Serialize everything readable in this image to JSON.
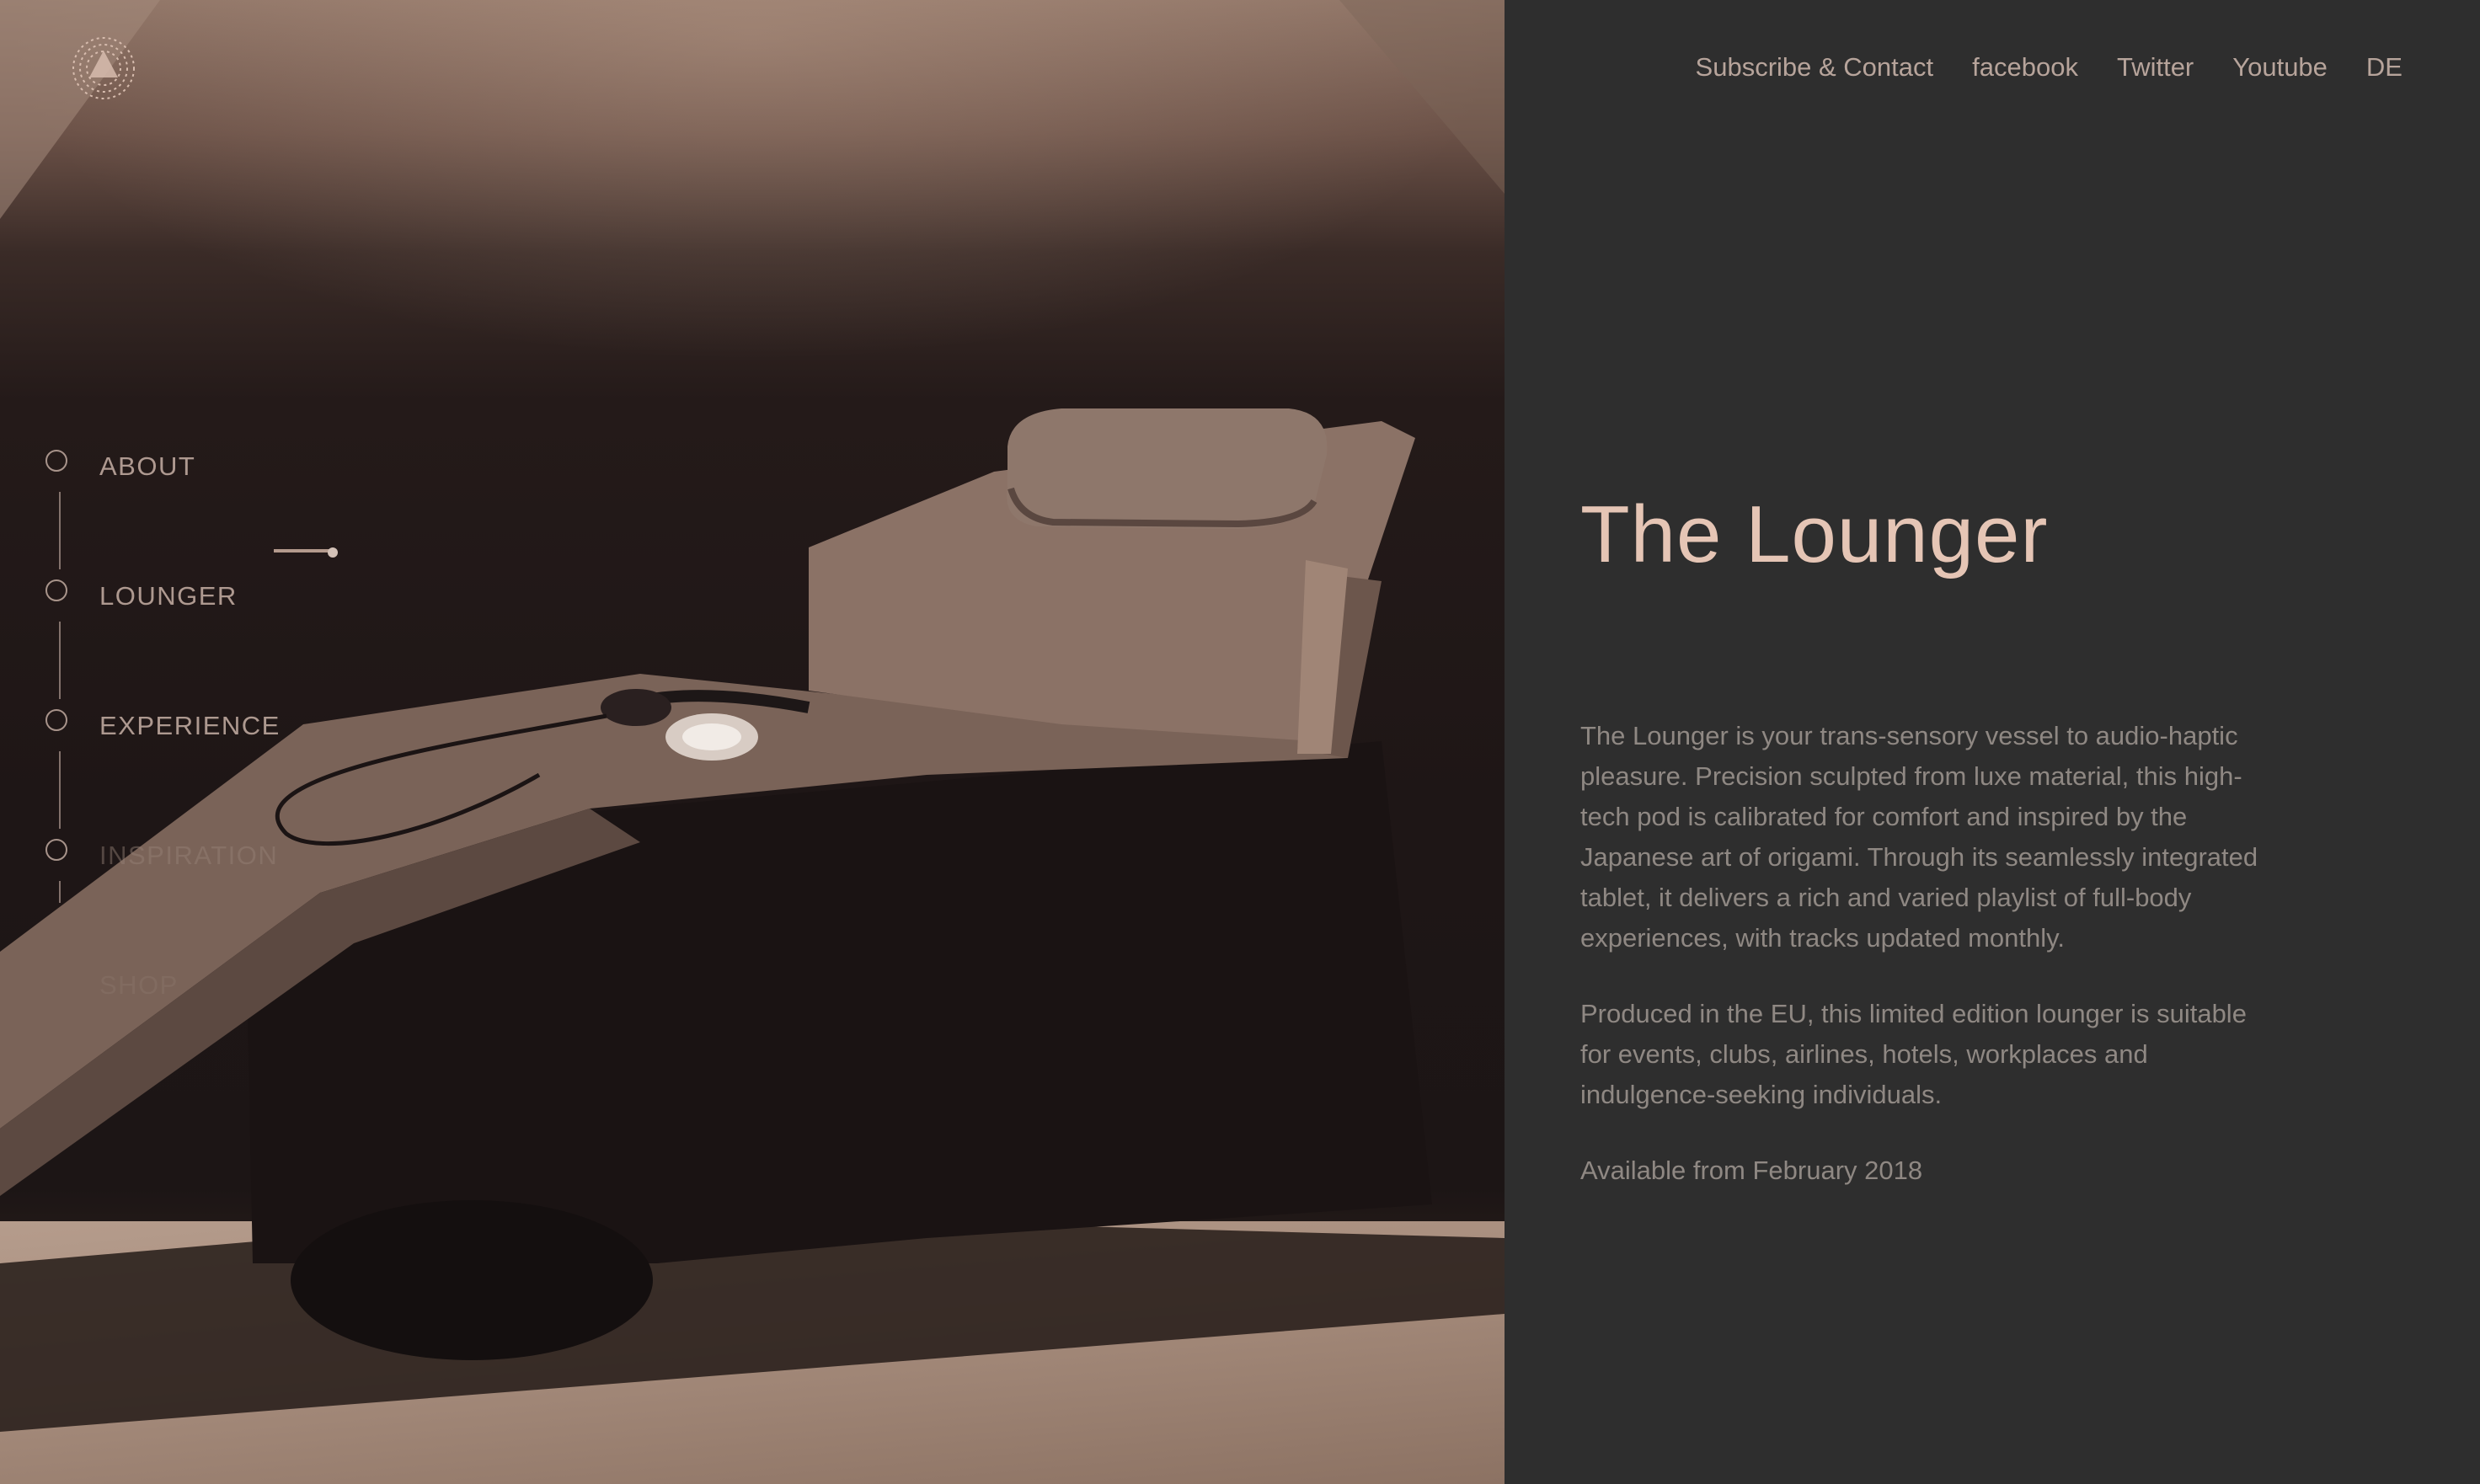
{
  "brand": {
    "logo": "dotted-triangle-logo"
  },
  "top_nav": {
    "links": [
      {
        "label": "Subscribe & Contact"
      },
      {
        "label": "facebook"
      },
      {
        "label": "Twitter"
      },
      {
        "label": "Youtube"
      },
      {
        "label": "DE"
      }
    ]
  },
  "section_nav": {
    "items": [
      {
        "label": "ABOUT"
      },
      {
        "label": "LOUNGER"
      },
      {
        "label": "EXPERIENCE"
      },
      {
        "label": "INSPIRATION"
      },
      {
        "label": "SHOP"
      }
    ]
  },
  "content": {
    "title": "The Lounger",
    "paragraphs": [
      "The Lounger is your trans-sensory vessel to audio-haptic pleasure. Precision sculpted from luxe material, this high-tech pod is calibrated for comfort and inspired by the Japanese art of origami. Through its seamlessly integrated tablet, it delivers a rich and varied playlist of full-body experiences, with tracks updated monthly.",
      "Produced in the EU, this limited edition lounger is suitable for events, clubs, airlines, hotels, workplaces and indulgence-seeking individuals.",
      "Available from February 2018"
    ]
  },
  "colors": {
    "panel_background": "#2e2e2e",
    "title": "#e5c5b5",
    "body_text": "#8f8883",
    "nav_text": "#b7a49b",
    "photo_tone": "#8f7466"
  }
}
